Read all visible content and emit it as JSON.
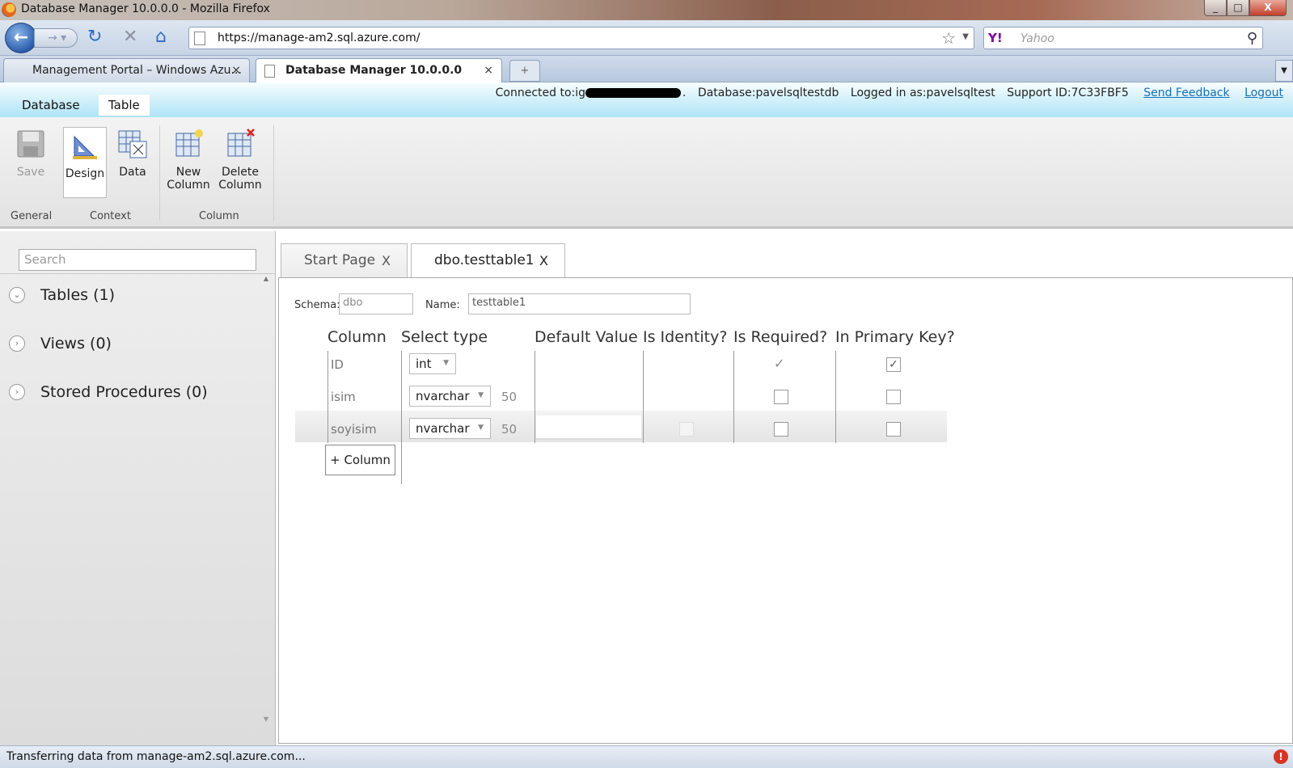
{
  "window": {
    "title": "Database Manager 10.0.0.0 - Mozilla Firefox",
    "minimize": "_",
    "maximize": "□",
    "close": "X"
  },
  "browser": {
    "url": "https://manage-am2.sql.azure.com/",
    "search_placeholder": "Yahoo",
    "search_engine_icon": "Y!",
    "tabs": [
      {
        "label": "Management Portal – Windows Azu...",
        "close": "×"
      },
      {
        "label": "Database Manager 10.0.0.0",
        "close": "×"
      }
    ],
    "new_tab": "+"
  },
  "app": {
    "nav_tabs": [
      "Database",
      "Table"
    ],
    "connection": {
      "connected_to": "Connected to:ig",
      "connected_suffix": ".",
      "database": "Database:pavelsqltestdb",
      "logged_in": "Logged in as:pavelsqltest",
      "support_id": "Support ID:7C33FBF5",
      "send_feedback": "Send Feedback",
      "logout": "Logout"
    }
  },
  "ribbon": {
    "buttons": {
      "save": "Save",
      "design": "Design",
      "data": "Data",
      "new_column_1": "New",
      "new_column_2": "Column",
      "delete_column_1": "Delete",
      "delete_column_2": "Column"
    },
    "groups": {
      "general": "General",
      "context": "Context",
      "column": "Column"
    }
  },
  "sidebar": {
    "search_placeholder": "Search",
    "items": [
      {
        "label": "Tables (1)",
        "icon": "chevron-down-icon"
      },
      {
        "label": "Views (0)",
        "icon": "chevron-right-icon"
      },
      {
        "label": "Stored Procedures (0)",
        "icon": "chevron-right-icon"
      }
    ]
  },
  "doc_tabs": [
    {
      "label": "Start Page",
      "close": "X"
    },
    {
      "label": "dbo.testtable1",
      "close": "X"
    }
  ],
  "designer": {
    "schema_label": "Schema:",
    "schema_value": "dbo",
    "name_label": "Name:",
    "name_value": "testtable1",
    "headers": [
      "Column",
      "Select type",
      "Default Value",
      "Is Identity?",
      "Is Required?",
      "In Primary Key?"
    ],
    "rows": [
      {
        "column": "ID",
        "type": "int",
        "length": "",
        "is_identity": true,
        "is_required": true,
        "in_primary_key": true
      },
      {
        "column": "isim",
        "type": "nvarchar",
        "length": "50",
        "is_identity": false,
        "is_required": false,
        "in_primary_key": false
      },
      {
        "column": "soyisim",
        "type": "nvarchar",
        "length": "50",
        "is_identity": false,
        "is_required": false,
        "in_primary_key": false
      }
    ],
    "add_column": "+ Column"
  },
  "status": {
    "text": "Transferring data from manage-am2.sql.azure.com..."
  },
  "glyphs": {
    "check": "✓",
    "dropdown_arrow": "▼"
  }
}
